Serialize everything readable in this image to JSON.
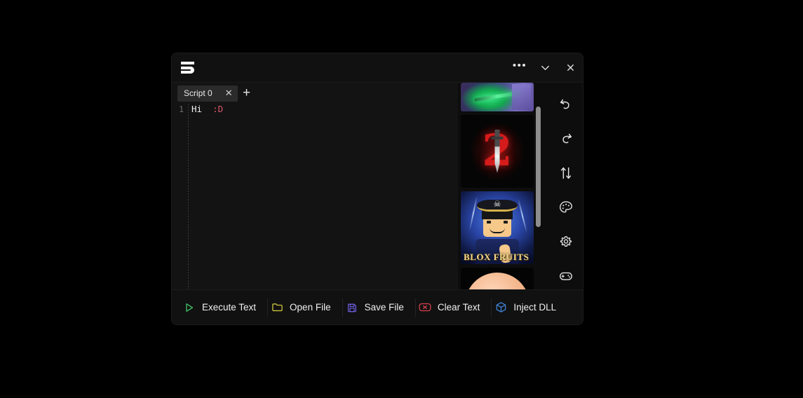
{
  "window": {
    "logo_name": "brand-logo-s",
    "controls": [
      {
        "name": "more-options",
        "glyph": "•••"
      },
      {
        "name": "minimize",
        "glyph": "⌄"
      },
      {
        "name": "close",
        "glyph": "✕"
      }
    ]
  },
  "editor": {
    "tabs": [
      {
        "label": "Script 0",
        "close_glyph": "✕",
        "active": true
      }
    ],
    "new_tab_glyph": "+",
    "lines": [
      {
        "number": "1",
        "plain": "Hi ",
        "operator": " :D"
      }
    ]
  },
  "games": {
    "thumbnails": [
      {
        "name": "game-thumb-green-weapon",
        "title": ""
      },
      {
        "name": "game-thumb-red-two-dagger",
        "title": "2"
      },
      {
        "name": "game-thumb-blox-fruits",
        "title": "BLOX\nFRUITS"
      },
      {
        "name": "game-thumb-peach-circle",
        "title": ""
      }
    ],
    "scrollbar_color": "#8d8d8d"
  },
  "rail": {
    "buttons": [
      {
        "name": "undo-icon",
        "label": "Undo"
      },
      {
        "name": "redo-icon",
        "label": "Redo"
      },
      {
        "name": "transfer-icon",
        "label": "Transfer"
      },
      {
        "name": "palette-icon",
        "label": "Theme"
      },
      {
        "name": "gear-icon",
        "label": "Settings"
      },
      {
        "name": "gamepad-icon",
        "label": "Games"
      }
    ]
  },
  "actions": [
    {
      "label": "Execute Text",
      "icon": "play-icon",
      "color": "#3fbf63"
    },
    {
      "label": "Open File",
      "icon": "folder-icon",
      "color": "#c9c23f"
    },
    {
      "label": "Save File",
      "icon": "floppy-icon",
      "color": "#6f5ee0"
    },
    {
      "label": "Clear Text",
      "icon": "clear-x-icon",
      "color": "#d6444d"
    },
    {
      "label": "Inject DLL",
      "icon": "cube-icon",
      "color": "#3d7fd1"
    }
  ],
  "colors": {
    "window_bg": "#111111",
    "body_bg": "#0d0d0d",
    "editor_bg": "#131313",
    "tab_active": "#2b2b2b",
    "text": "#f0f0f0",
    "line_number": "#6e6e6e",
    "code_operator": "#d9596a"
  }
}
